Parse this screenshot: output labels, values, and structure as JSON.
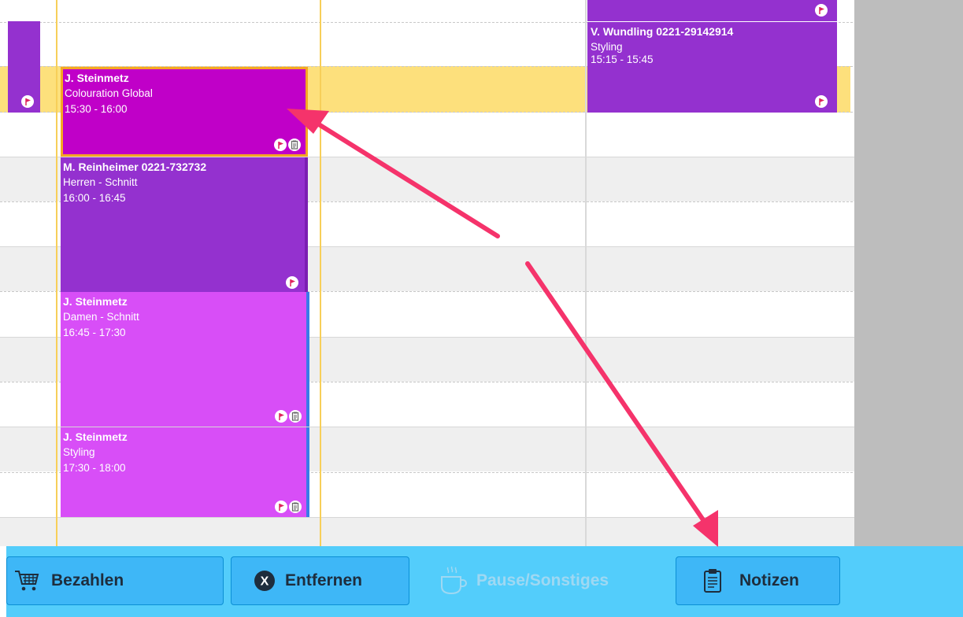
{
  "appointments": [
    {
      "name": "J. Steinmetz",
      "service": "Colouration Global",
      "time": "15:30 - 16:00"
    },
    {
      "name": "M. Reinheimer 0221-732732",
      "service": "Herren - Schnitt",
      "time": "16:00 - 16:45"
    },
    {
      "name": "J. Steinmetz",
      "service": "Damen - Schnitt",
      "time": "16:45 - 17:30"
    },
    {
      "name": "J. Steinmetz",
      "service": "Styling",
      "time": "17:30 - 18:00"
    },
    {
      "name": "V. Wundling 0221-29142914",
      "service": "Styling",
      "time": "15:15 - 15:45"
    }
  ],
  "toolbar": {
    "pay_label": "Bezahlen",
    "remove_label": "Entfernen",
    "pause_label": "Pause/Sonstiges",
    "notes_label": "Notizen"
  },
  "icons": {
    "flag": "flag-icon",
    "note": "clipboard-icon",
    "pay": "shopping-cart-icon",
    "remove": "x-circle-icon",
    "pause": "coffee-cup-icon",
    "notes": "clipboard-icon"
  },
  "colors": {
    "selected_appointment": "#c000c8",
    "purple_appointment": "#9431cf",
    "pink_appointment": "#d84ef7",
    "highlight_row": "#fde07c",
    "selection_border": "#f5a623",
    "toolbar": "#53cdfb",
    "toolbar_button": "#3eb7f7",
    "annotation_arrow": "#f5336b",
    "closed_area": "#bdbdbd"
  }
}
